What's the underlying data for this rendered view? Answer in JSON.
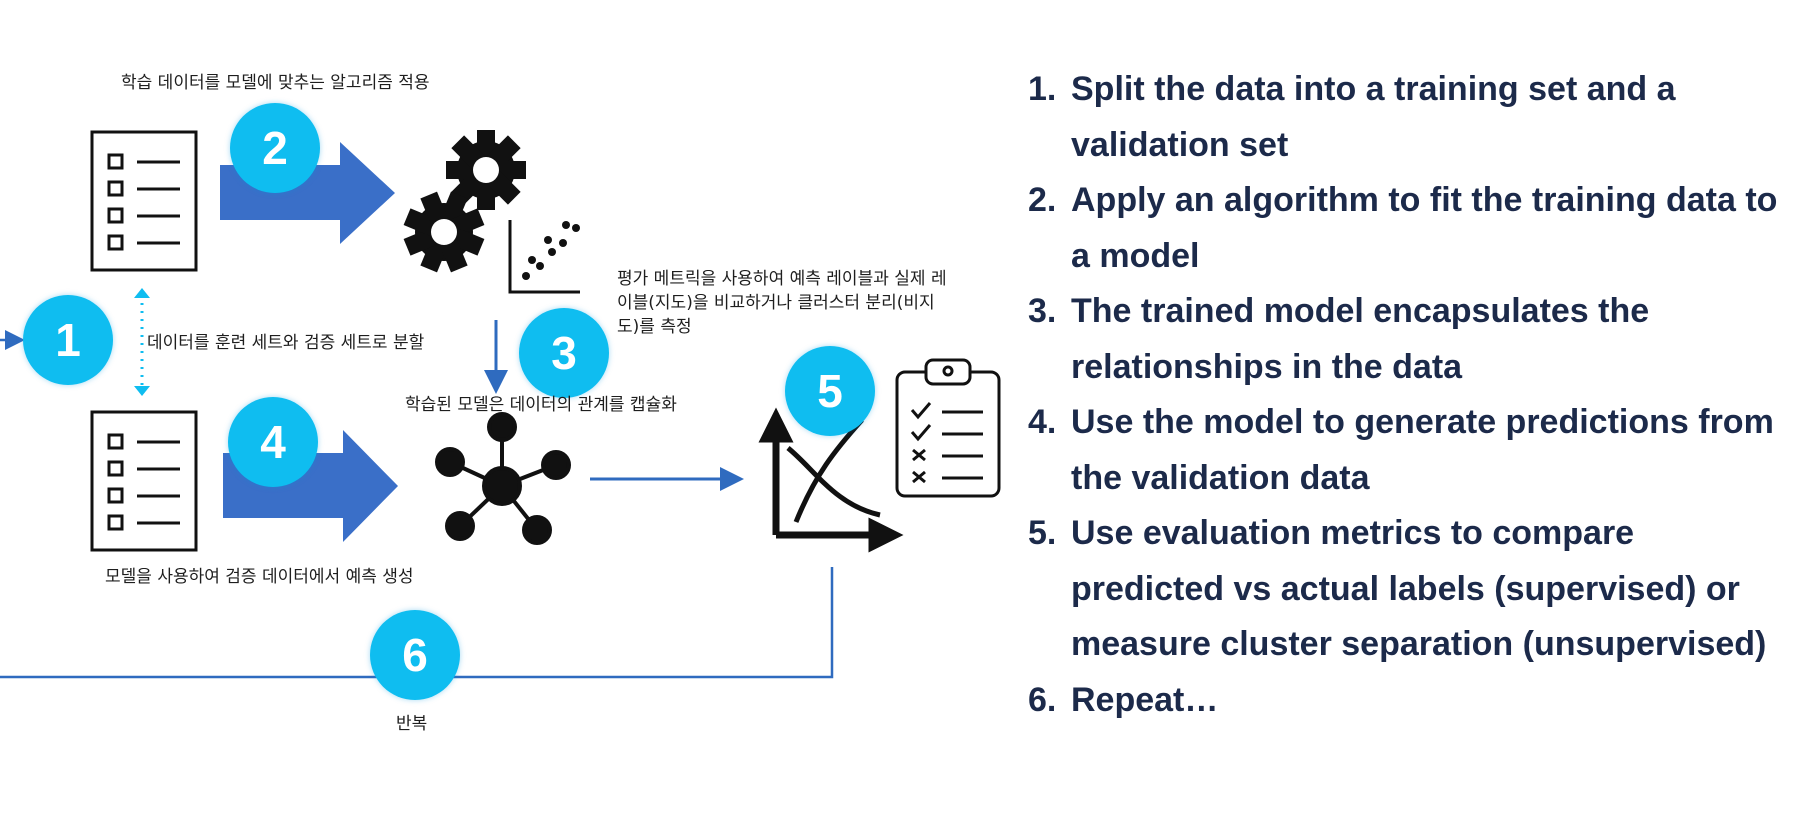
{
  "diagram": {
    "labels": {
      "fit": "학습 데이터를 모델에 맞추는 알고리즘 적용",
      "split": "데이터를 훈련 세트와 검증 세트로 분할",
      "evaluate": "평가 메트릭을 사용하여 예측 레이블과 실제 레이블(지도)을 비교하거나 클러스터 분리(비지도)를 측정",
      "encapsulate": "학습된 모델은 데이터의 관계를 캡슐화",
      "predict": "모델을 사용하여 검증 데이터에서 예측 생성",
      "repeat": "반복"
    },
    "badges": [
      "1",
      "2",
      "3",
      "4",
      "5",
      "6"
    ],
    "icons": {
      "training_doc": "checklist-document-icon",
      "validation_doc": "checklist-document-icon",
      "algorithm": "gears-icon",
      "scatter": "scatter-plot-icon",
      "model": "network-hub-icon",
      "metrics_chart": "crossing-curves-chart-icon",
      "clipboard": "clipboard-checklist-icon"
    },
    "colors": {
      "badge": "#0fbdf0",
      "arrow": "#3a6fc8",
      "line": "#2f6bbf",
      "icon": "#111111",
      "text": "#1c2a4a"
    }
  },
  "steps": [
    {
      "num": "1.",
      "text": "Split the data into a training set and a validation set"
    },
    {
      "num": "2.",
      "text": "Apply an algorithm to fit the training data to a model"
    },
    {
      "num": "3.",
      "text": "The trained model encapsulates the relationships in the data"
    },
    {
      "num": "4.",
      "text": "Use the model to generate predictions from the validation data"
    },
    {
      "num": "5.",
      "text": "Use evaluation metrics to compare predicted vs actual labels (supervised) or measure cluster separation (unsupervised)"
    },
    {
      "num": "6.",
      "text": "Repeat…"
    }
  ]
}
